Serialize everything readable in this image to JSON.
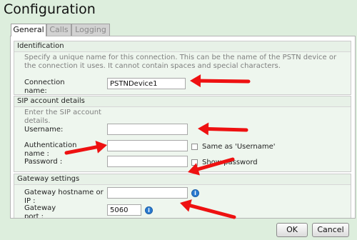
{
  "page": {
    "title": "Configuration"
  },
  "tabs": [
    {
      "label": "General",
      "active": true
    },
    {
      "label": "Calls",
      "active": false
    },
    {
      "label": "Logging",
      "active": false
    }
  ],
  "identification": {
    "heading": "Identification",
    "description": "Specify a unique name for this connection. This can be the name of the PSTN device or the connection it uses. It cannot contain spaces and special characters.",
    "connection_name_label": "Connection name:",
    "connection_name_value": "PSTNDevice1"
  },
  "sip": {
    "heading": "SIP account details",
    "description": "Enter the SIP account details.",
    "username_label": "Username:",
    "username_value": "",
    "auth_label": "Authentication name :",
    "auth_value": "",
    "same_as_username_label": "Same as 'Username'",
    "password_label": "Password :",
    "password_value": "",
    "show_password_label": "Show password"
  },
  "gateway": {
    "heading": "Gateway settings",
    "hostname_label": "Gateway hostname or IP :",
    "hostname_value": "",
    "port_label": "Gateway port :",
    "port_value": "5060"
  },
  "buttons": {
    "ok": "OK",
    "cancel": "Cancel"
  },
  "annotation": {
    "arrow_color": "#ee1111"
  }
}
